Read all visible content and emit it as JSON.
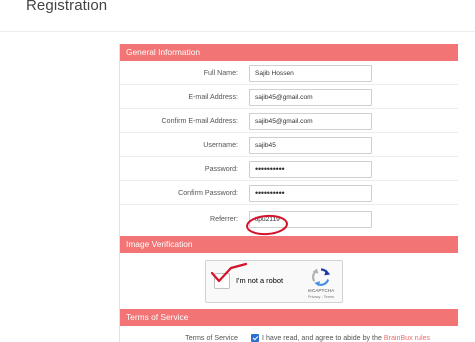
{
  "page": {
    "title": "Registration"
  },
  "general": {
    "header": "General Information",
    "fields": [
      {
        "label": "Full Name:",
        "value": "Sajib Hossen"
      },
      {
        "label": "E-mail Address:",
        "value": "sajib45@gmail.com"
      },
      {
        "label": "Confirm E-mail Address:",
        "value": "sajib45@gmail.com"
      },
      {
        "label": "Username:",
        "value": "sajib45"
      },
      {
        "label": "Password:",
        "value": "••••••••••"
      },
      {
        "label": "Confirm Password:",
        "value": "••••••••••"
      },
      {
        "label": "Referrer:",
        "value": "tipu2119"
      }
    ]
  },
  "verification": {
    "header": "Image Verification",
    "captcha_label": "I'm not a robot",
    "captcha_checked": false,
    "brand": "reCAPTCHA",
    "links": "Privacy - Terms"
  },
  "tos": {
    "header": "Terms of Service",
    "label": "Terms of Service",
    "checked": true,
    "text_prefix": "I have read, and agree to abide by the",
    "link_text": "BrainBux rules"
  },
  "colors": {
    "section_header": "#f27474",
    "link": "#ef6b6b",
    "checkbox": "#2d6fd1",
    "annotation": "#d3132a"
  },
  "icons": {
    "captcha_logo": "recaptcha-icon",
    "tos_check": "checkbox-checked-icon"
  }
}
